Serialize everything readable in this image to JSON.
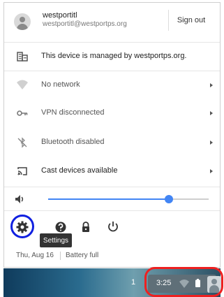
{
  "user": {
    "name": "westportitl",
    "email": "westportitl@westportps.org",
    "signout_label": "Sign out"
  },
  "rows": [
    {
      "label": "This device is managed by westportps.org.",
      "icon": "managed-building-icon"
    },
    {
      "label": "No network",
      "icon": "wifi-icon"
    },
    {
      "label": "VPN disconnected",
      "icon": "vpn-key-icon"
    },
    {
      "label": "Bluetooth disabled",
      "icon": "bluetooth-disabled-icon"
    },
    {
      "label": "Cast devices available",
      "icon": "cast-icon"
    }
  ],
  "volume": {
    "level_percent": 75,
    "icon": "volume-icon"
  },
  "bottom_icons": [
    "settings-icon",
    "help-icon",
    "lock-icon",
    "power-icon"
  ],
  "tooltip": "Settings",
  "status": {
    "date": "Thu, Aug 16",
    "battery": "Battery full"
  },
  "shelf": {
    "count": "1",
    "time": "3:25"
  },
  "colors": {
    "accent": "#4285f4",
    "settings_highlight": "#1020e0",
    "status_highlight": "#ee2020"
  }
}
